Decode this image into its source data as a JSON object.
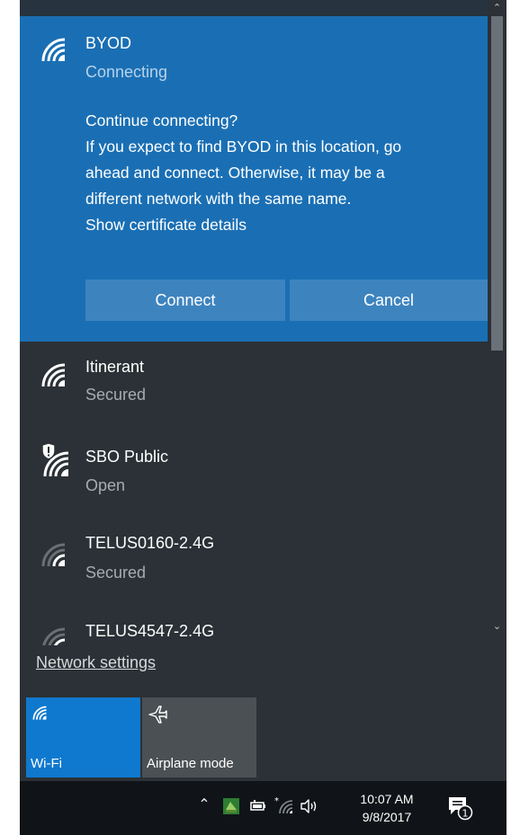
{
  "selected_network": {
    "name": "BYOD",
    "status": "Connecting",
    "prompt_lines": [
      "Continue connecting?",
      "If you expect to find BYOD in this location, go",
      "ahead and connect. Otherwise, it may be a",
      "different network with the same name."
    ],
    "certificate_link": "Show certificate details",
    "connect_label": "Connect",
    "cancel_label": "Cancel"
  },
  "networks": [
    {
      "name": "Itinerant",
      "status": "Secured",
      "icon": "wifi-full-icon"
    },
    {
      "name": "SBO Public",
      "status": "Open",
      "icon": "wifi-open-shield-icon"
    },
    {
      "name": "TELUS0160-2.4G",
      "status": "Secured",
      "icon": "wifi-weak-icon"
    },
    {
      "name": "TELUS4547-2.4G",
      "status": "",
      "icon": "wifi-weak-icon"
    }
  ],
  "network_settings_label": "Network settings",
  "quick_actions": {
    "wifi_label": "Wi-Fi",
    "airplane_label": "Airplane mode"
  },
  "taskbar": {
    "time": "10:07 AM",
    "date": "9/8/2017",
    "notification_count": "1"
  },
  "colors": {
    "accent": "#1a6fb4",
    "tile_active": "#0f79cf",
    "flyout_bg": "#2b3136"
  }
}
